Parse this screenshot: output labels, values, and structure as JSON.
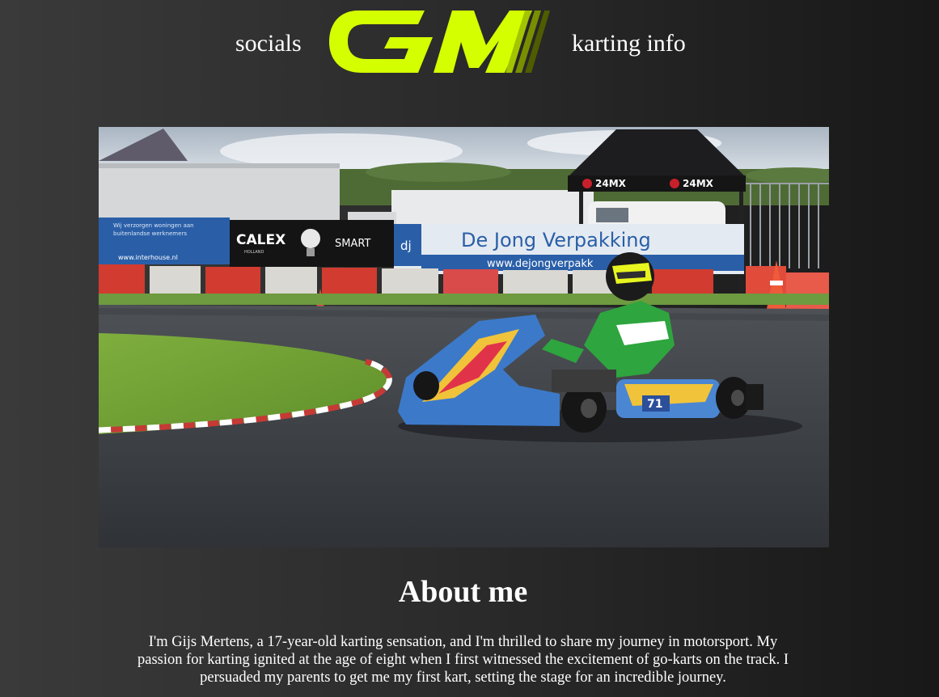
{
  "nav": {
    "left_link": "socials",
    "right_link": "karting info",
    "logo_text": "GM"
  },
  "hero": {
    "banners": {
      "interhouse_line1": "Wij verzorgen woningen aan",
      "interhouse_line2": "buitenlandse werknemers",
      "interhouse_url": "www.interhouse.nl",
      "calex": "CALEX",
      "calex_sub": "HOLLAND",
      "smart": "SMART",
      "dejong_mark": "dj",
      "dejong_title": "De Jong Verpakking",
      "dejong_url": "www.dejongverpakk",
      "tent_brand_left": "24MX",
      "tent_brand_right": "24MX",
      "kart_number": "71"
    }
  },
  "about": {
    "title": "About me",
    "line1": "I'm Gijs Mertens, a 17-year-old karting sensation, and I'm thrilled to share my journey in motorsport. My",
    "line2": "passion for karting ignited at the age of eight when I first witnessed the excitement of go-karts on the track. I",
    "line3": "persuaded my parents to get me my first kart, setting the stage for an incredible journey."
  },
  "colors": {
    "logo_lime": "#d4ff00",
    "background_dark": "#181818",
    "background_light": "#3a3a3a"
  }
}
